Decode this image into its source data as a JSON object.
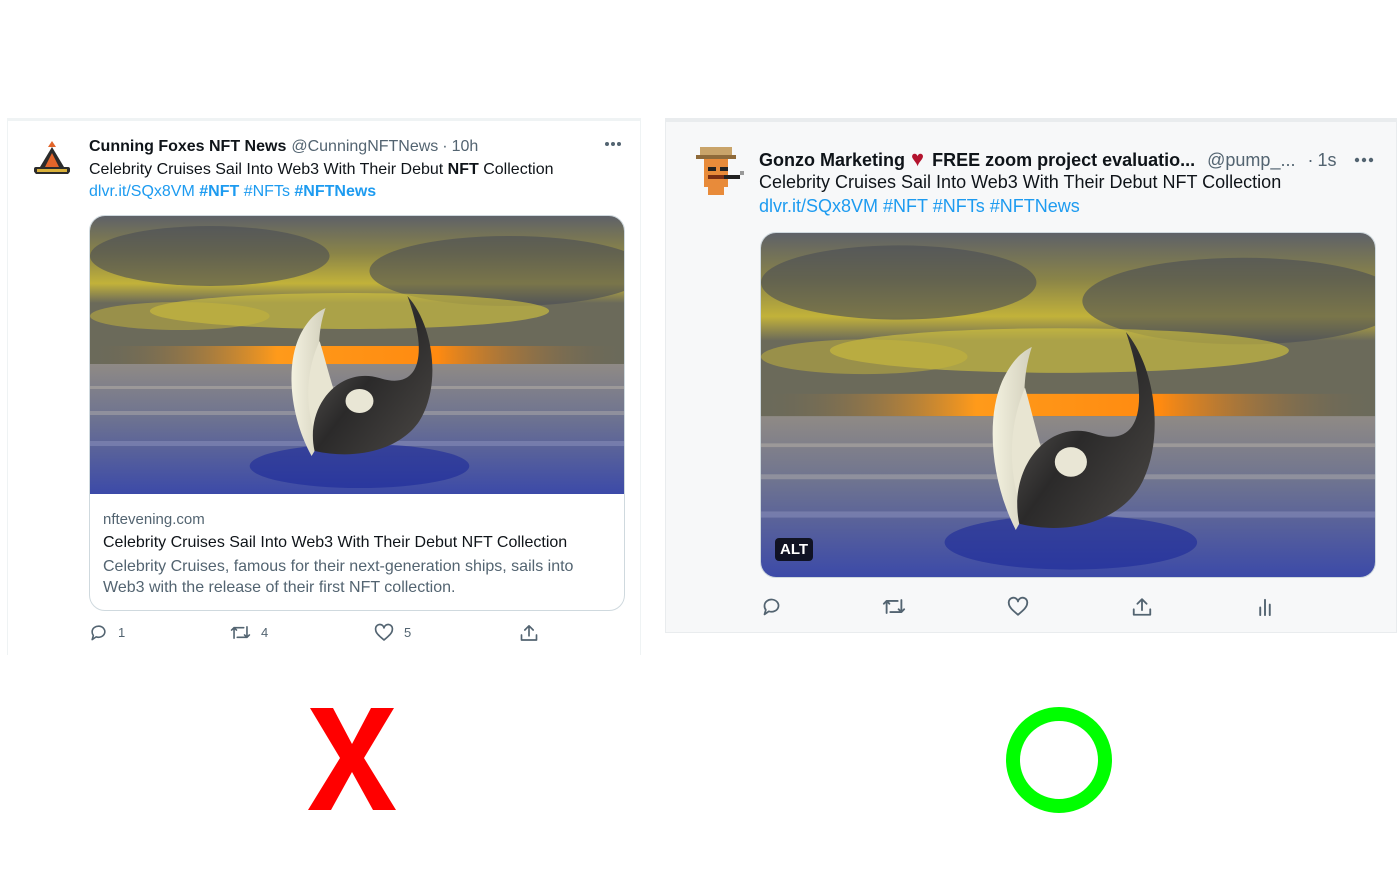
{
  "left_tweet": {
    "author_name": "Cunning Foxes NFT News",
    "handle": "@CunningNFTNews",
    "separator": "·",
    "time": "10h",
    "more_icon": "more-horizontal-icon",
    "text_before": "Celebrity Cruises Sail Into Web3 With Their Debut ",
    "text_bold": "NFT",
    "text_after": " Collection",
    "link": "dlvr.it/SQx8VM",
    "hashtags": [
      "#NFT",
      "#NFTs",
      "#NFTNews"
    ],
    "card": {
      "domain": "nftevening.com",
      "title": "Celebrity Cruises Sail Into Web3 With Their Debut NFT Collection",
      "description_line1": "Celebrity Cruises, famous for their next-generation ships, sails into",
      "description_line2": "Web3 with the release of their first NFT collection."
    },
    "actions": {
      "reply_count": "1",
      "retweet_count": "4",
      "like_count": "5"
    }
  },
  "right_tweet": {
    "author_name": "Gonzo Marketing",
    "heart": "♥",
    "author_suffix": "FREE zoom project evaluatio...",
    "handle": "@pump_...",
    "separator": "·",
    "time": "1s",
    "more_icon": "more-horizontal-icon",
    "text": "Celebrity Cruises Sail Into Web3 With Their Debut NFT Collection",
    "link": "dlvr.it/SQx8VM",
    "hashtags": [
      "#NFT",
      "#NFTs",
      "#NFTNews"
    ],
    "alt_label": "ALT"
  },
  "verdict": {
    "wrong_mark": "X",
    "right_mark": "O",
    "wrong_color": "#ff0000",
    "right_color": "#00ff00"
  },
  "colors": {
    "link_blue": "#1d9bf0",
    "muted_gray": "#536471",
    "border_gray": "#cfd9de"
  }
}
